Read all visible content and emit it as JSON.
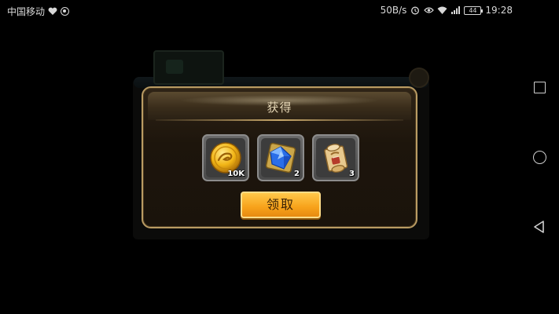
{
  "status_bar": {
    "carrier": "中国移动",
    "net_speed": "50B/s",
    "battery": "44",
    "time": "19:28"
  },
  "dialog": {
    "title": "获得",
    "items": [
      {
        "icon": "gold-coin-icon",
        "count": "10K"
      },
      {
        "icon": "blue-gem-icon",
        "count": "2"
      },
      {
        "icon": "scroll-icon",
        "count": "3"
      }
    ],
    "claim_label": "领取"
  },
  "colors": {
    "dialog_border": "#b99b63",
    "button": "#f7a21a",
    "title_text": "#e6d7b6"
  }
}
